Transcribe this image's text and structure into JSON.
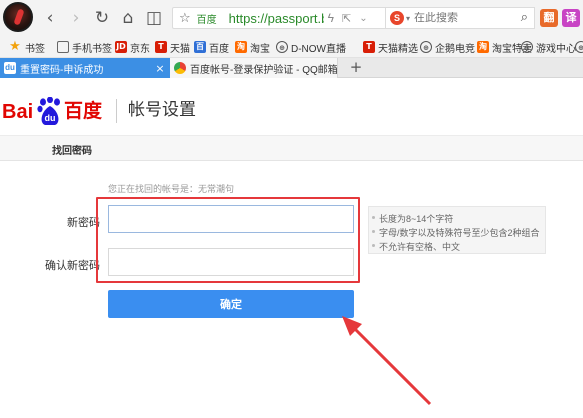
{
  "browser": {
    "address_site_label": "百度",
    "url": "https://passport.baidu.com",
    "search_placeholder": "在此搜索",
    "search_engine_glyph": "S",
    "toolbar_icon_1": "翻",
    "toolbar_icon_2": "译",
    "toolbar_icon_1_color": "#e86a2a",
    "toolbar_icon_2_color": "#c844c4"
  },
  "bookmarks": [
    {
      "label": "书签",
      "icon": "star-icon",
      "glyph": "★"
    },
    {
      "label": "手机书签",
      "icon": "phone-icon",
      "glyph": ""
    },
    {
      "label": "京东",
      "icon": "jd-icon",
      "glyph": "JD",
      "color": "#d81e06"
    },
    {
      "label": "天猫",
      "icon": "tmall-icon",
      "glyph": "T",
      "color": "#d81e06"
    },
    {
      "label": "百度",
      "icon": "baidu-icon",
      "glyph": "百",
      "color": "#2f6fd6"
    },
    {
      "label": "淘宝",
      "icon": "taobao-icon",
      "glyph": "淘",
      "color": "#ff6a00"
    },
    {
      "label": "D-NOW直播",
      "icon": "globe-icon",
      "glyph": "⊕"
    },
    {
      "label": "天猫精选",
      "icon": "tmall-icon",
      "glyph": "T",
      "color": "#d81e06"
    },
    {
      "label": "企鹅电竞",
      "icon": "globe-icon",
      "glyph": "⊕"
    },
    {
      "label": "淘宝特卖",
      "icon": "taobao-icon",
      "glyph": "淘",
      "color": "#ff6a00"
    },
    {
      "label": "游戏中心",
      "icon": "globe-icon",
      "glyph": "⊕"
    },
    {
      "label": "h",
      "icon": "globe-icon",
      "glyph": "⊕"
    }
  ],
  "tabs": [
    {
      "title": "重置密码-申诉成功",
      "fav": "du"
    },
    {
      "title": "百度帐号-登录保护验证 - QQ邮箱",
      "fav": ""
    }
  ],
  "header": {
    "logo_bai": "Bai",
    "logo_du": "du",
    "logo_cn": "百度",
    "title": "帐号设置"
  },
  "subnav": {
    "label": "找回密码"
  },
  "form": {
    "hint": "您正在找回的帐号是：无常潮句",
    "new_password_label": "新密码",
    "confirm_password_label": "确认新密码",
    "submit_label": "确定"
  },
  "rules": [
    "长度为8~14个字符",
    "字母/数字以及特殊符号至少包含2种组合",
    "不允许有空格、中文"
  ],
  "colors": {
    "accent": "#3a8ef0",
    "baidu_red": "#e10602",
    "baidu_blue": "#2319dc",
    "annotation_red": "#e5383b"
  }
}
